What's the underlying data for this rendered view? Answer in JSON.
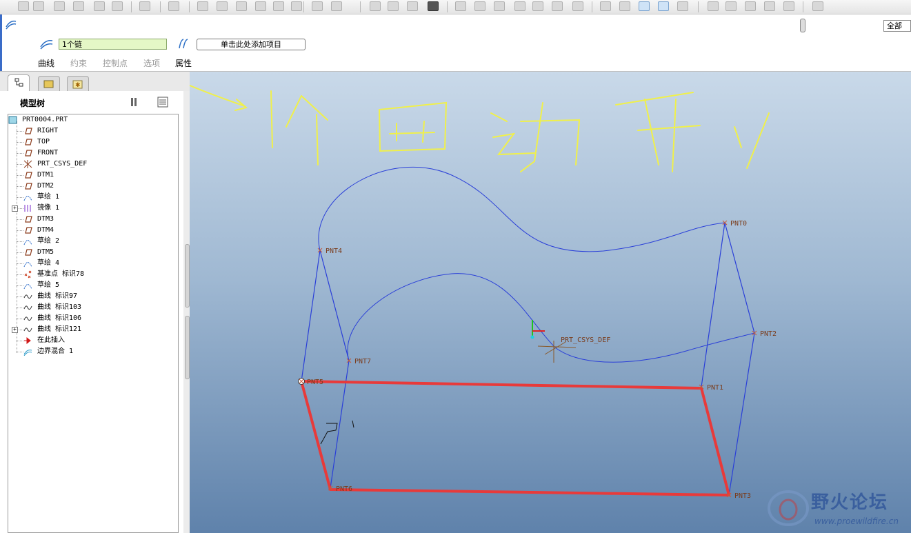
{
  "dashboard": {
    "chain_value": "1个链",
    "add_item_placeholder": "单击此处添加项目",
    "tabs": [
      {
        "label": "曲线",
        "enabled": true
      },
      {
        "label": "约束",
        "enabled": false
      },
      {
        "label": "控制点",
        "enabled": false
      },
      {
        "label": "选项",
        "enabled": false
      },
      {
        "label": "属性",
        "enabled": true
      }
    ],
    "filter_value": "全部"
  },
  "model_tree": {
    "title": "模型树",
    "items": [
      {
        "label": "PRT0004.PRT",
        "icon": "part-icon",
        "level": 0,
        "expandable": false
      },
      {
        "label": "RIGHT",
        "icon": "datum-plane-icon",
        "level": 1,
        "expandable": false
      },
      {
        "label": "TOP",
        "icon": "datum-plane-icon",
        "level": 1,
        "expandable": false
      },
      {
        "label": "FRONT",
        "icon": "datum-plane-icon",
        "level": 1,
        "expandable": false
      },
      {
        "label": "PRT_CSYS_DEF",
        "icon": "csys-icon",
        "level": 1,
        "expandable": false
      },
      {
        "label": "DTM1",
        "icon": "datum-plane-icon",
        "level": 1,
        "expandable": false
      },
      {
        "label": "DTM2",
        "icon": "datum-plane-icon",
        "level": 1,
        "expandable": false
      },
      {
        "label": "草绘 1",
        "icon": "sketch-icon",
        "level": 1,
        "expandable": false
      },
      {
        "label": "镜像 1",
        "icon": "mirror-icon",
        "level": 1,
        "expandable": true
      },
      {
        "label": "DTM3",
        "icon": "datum-plane-icon",
        "level": 1,
        "expandable": false
      },
      {
        "label": "DTM4",
        "icon": "datum-plane-icon",
        "level": 1,
        "expandable": false
      },
      {
        "label": "草绘 2",
        "icon": "sketch-icon",
        "level": 1,
        "expandable": false
      },
      {
        "label": "DTM5",
        "icon": "datum-plane-icon",
        "level": 1,
        "expandable": false
      },
      {
        "label": "草绘 4",
        "icon": "sketch-icon",
        "level": 1,
        "expandable": false
      },
      {
        "label": "基准点 标识78",
        "icon": "datum-point-icon",
        "level": 1,
        "expandable": false
      },
      {
        "label": "草绘 5",
        "icon": "sketch-icon",
        "level": 1,
        "expandable": false
      },
      {
        "label": "曲线 标识97",
        "icon": "curve-icon",
        "level": 1,
        "expandable": false
      },
      {
        "label": "曲线 标识103",
        "icon": "curve-icon",
        "level": 1,
        "expandable": false
      },
      {
        "label": "曲线 标识106",
        "icon": "curve-icon",
        "level": 1,
        "expandable": false
      },
      {
        "label": "曲线 标识121",
        "icon": "curve-icon",
        "level": 1,
        "expandable": true
      },
      {
        "label": "在此插入",
        "icon": "insert-arrow-icon",
        "level": 1,
        "expandable": false
      },
      {
        "label": "边界混合 1",
        "icon": "boundary-blend-icon",
        "level": 1,
        "expandable": false
      }
    ]
  },
  "viewport": {
    "points": [
      "PNT0",
      "PNT1",
      "PNT2",
      "PNT3",
      "PNT4",
      "PNT5",
      "PNT6",
      "PNT7"
    ],
    "csys_label": "PRT_CSYS_DEF",
    "annotation": "1个四边形"
  },
  "watermark": {
    "title": "野火论坛",
    "url": "www.proewildfire.cn"
  },
  "colors": {
    "curve_blue": "#2a3fd8",
    "selected_chain_red": "#e83a3a",
    "annotation_yellow": "#f0f04a",
    "point_brown": "#7a3b1a",
    "chain_field_bg": "#e4f7c6"
  }
}
